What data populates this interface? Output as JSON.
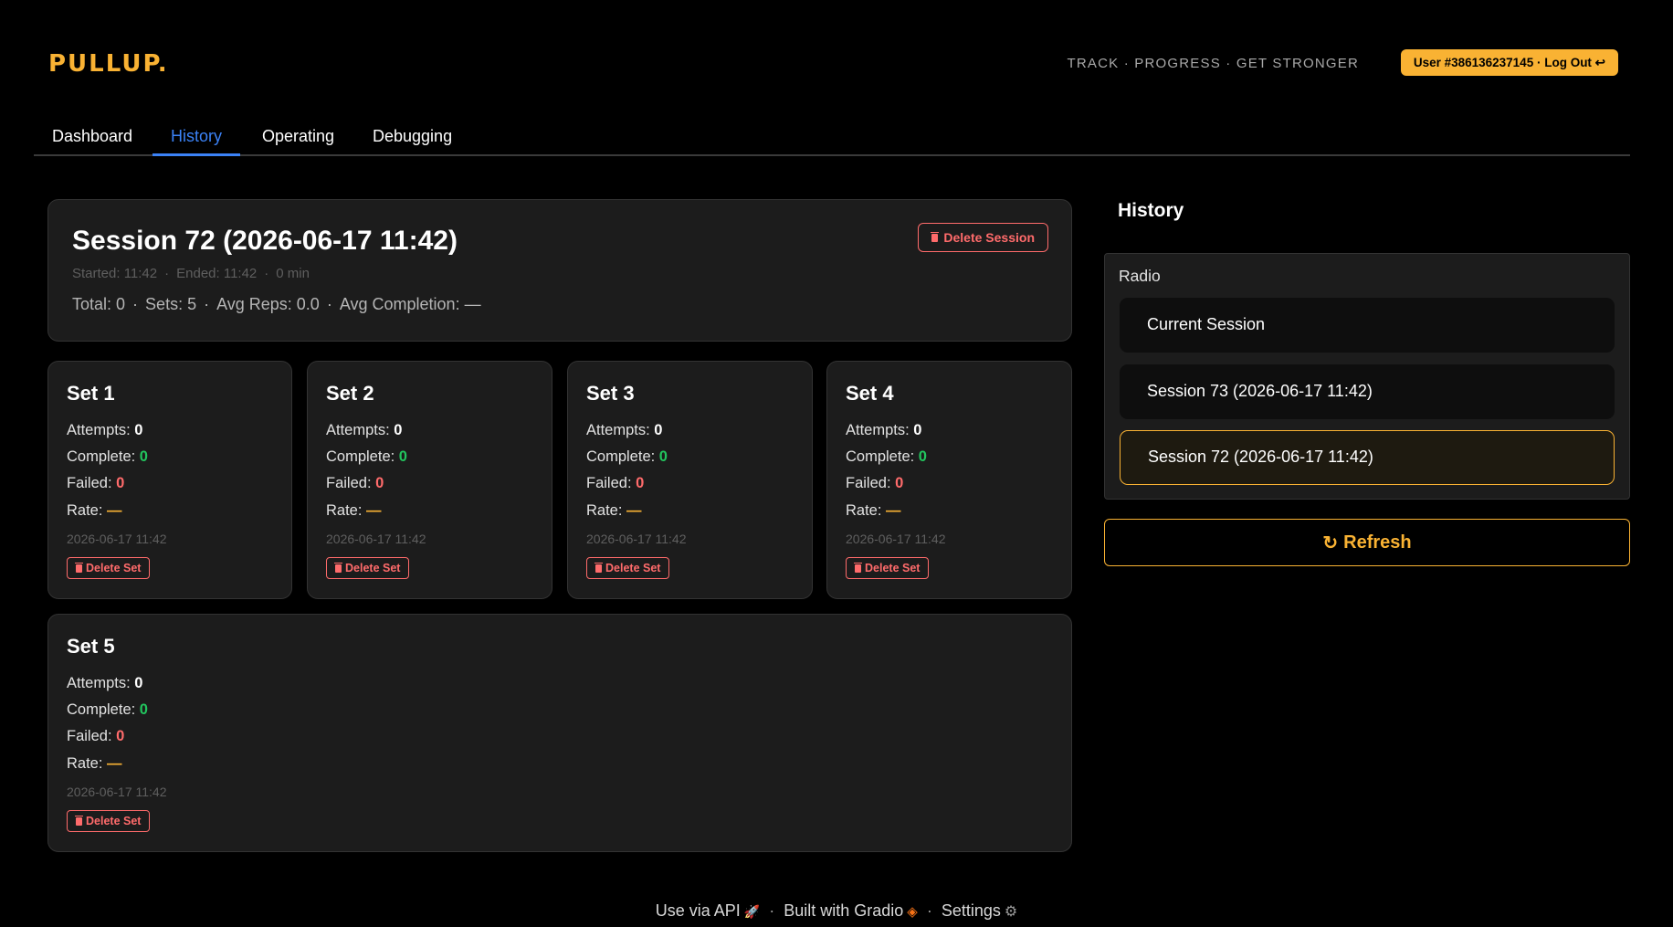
{
  "app": {
    "logo": "PULLUP.",
    "tagline": "TRACK · PROGRESS · GET STRONGER",
    "user_button": "User #386136237145 · Log Out ↩"
  },
  "tabs": [
    {
      "label": "Dashboard",
      "active": false
    },
    {
      "label": "History",
      "active": true
    },
    {
      "label": "Operating",
      "active": false
    },
    {
      "label": "Debugging",
      "active": false
    }
  ],
  "session": {
    "title": "Session 72 (2026-06-17 11:42)",
    "delete_label": "Delete Session",
    "started": "Started: 11:42",
    "ended": "Ended: 11:42",
    "duration": "0 min",
    "total": "Total: 0",
    "sets": "Sets: 5",
    "avg_reps": "Avg Reps: 0.0",
    "avg_completion": "Avg Completion: —"
  },
  "set_labels": {
    "attempts": "Attempts:",
    "complete": "Complete:",
    "failed": "Failed:",
    "rate": "Rate:",
    "delete": "Delete Set"
  },
  "sets": [
    {
      "title": "Set 1",
      "attempts": "0",
      "complete": "0",
      "failed": "0",
      "rate": "—",
      "time": "2026-06-17 11:42"
    },
    {
      "title": "Set 2",
      "attempts": "0",
      "complete": "0",
      "failed": "0",
      "rate": "—",
      "time": "2026-06-17 11:42"
    },
    {
      "title": "Set 3",
      "attempts": "0",
      "complete": "0",
      "failed": "0",
      "rate": "—",
      "time": "2026-06-17 11:42"
    },
    {
      "title": "Set 4",
      "attempts": "0",
      "complete": "0",
      "failed": "0",
      "rate": "—",
      "time": "2026-06-17 11:42"
    },
    {
      "title": "Set 5",
      "attempts": "0",
      "complete": "0",
      "failed": "0",
      "rate": "—",
      "time": "2026-06-17 11:42"
    }
  ],
  "sidebar": {
    "title": "History",
    "radio_label": "Radio",
    "options": [
      "Current Session",
      "Session 73 (2026-06-17 11:42)",
      "Session 72 (2026-06-17 11:42)"
    ],
    "selected": "Session 72 (2026-06-17 11:42)",
    "refresh_label": "Refresh"
  },
  "footer": {
    "api": "Use via API",
    "built": "Built with Gradio",
    "settings": "Settings"
  },
  "colors": {
    "accent": "#f9b233",
    "tab_active": "#3b82f6",
    "danger": "#ff6b6b",
    "success": "#22c55e"
  },
  "icons": [
    "trash-icon",
    "refresh-icon",
    "rocket-icon",
    "gradio-icon",
    "gear-icon",
    "logout-arrow-icon"
  ]
}
